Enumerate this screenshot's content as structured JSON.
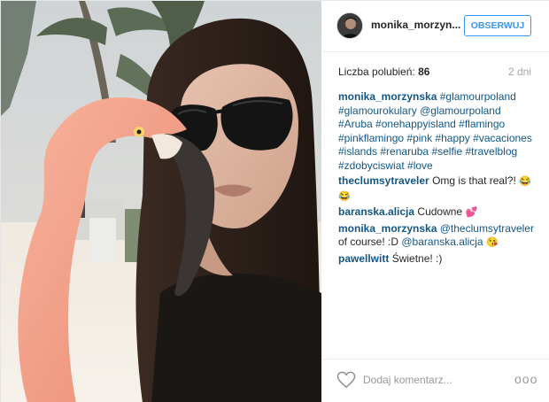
{
  "post": {
    "username": "monika_morzyn...",
    "follow_label": "OBSERWUJ",
    "likes_label": "Liczba polubień:",
    "likes_count": "86",
    "age": "2 dni",
    "comment_placeholder": "Dodaj komentarz...",
    "more_label": "ooo"
  },
  "comments": [
    {
      "user": "monika_morzynska",
      "parts": [
        {
          "type": "tag",
          "text": "#glamourpoland"
        },
        {
          "type": "tag",
          "text": "#glamourokulary"
        },
        {
          "type": "tag",
          "text": "@glamourpoland"
        },
        {
          "type": "tag",
          "text": "#Aruba"
        },
        {
          "type": "tag",
          "text": "#onehappyisland"
        },
        {
          "type": "tag",
          "text": "#flamingo"
        },
        {
          "type": "tag",
          "text": "#pinkflamingo"
        },
        {
          "type": "tag",
          "text": "#pink"
        },
        {
          "type": "tag",
          "text": "#happy"
        },
        {
          "type": "tag",
          "text": "#vacaciones"
        },
        {
          "type": "tag",
          "text": "#islands"
        },
        {
          "type": "tag",
          "text": "#renaruba"
        },
        {
          "type": "tag",
          "text": "#selfie"
        },
        {
          "type": "tag",
          "text": "#travelblog"
        },
        {
          "type": "tag",
          "text": "#zdobyciswiat"
        },
        {
          "type": "tag",
          "text": "#love"
        }
      ]
    },
    {
      "user": "theclumsytraveler",
      "parts": [
        {
          "type": "text",
          "text": "Omg is that real?!"
        },
        {
          "type": "emoji",
          "text": "😂😂"
        }
      ]
    },
    {
      "user": "baranska.alicja",
      "parts": [
        {
          "type": "text",
          "text": "Cudowne"
        },
        {
          "type": "emoji",
          "text": "💕"
        }
      ]
    },
    {
      "user": "monika_morzynska",
      "parts": [
        {
          "type": "tag",
          "text": "@theclumsytraveler"
        },
        {
          "type": "text",
          "text": "of course! :D"
        },
        {
          "type": "tag",
          "text": "@baranska.alicja"
        },
        {
          "type": "emoji",
          "text": "😘"
        }
      ]
    },
    {
      "user": "pawellwitt",
      "parts": [
        {
          "type": "text",
          "text": "Świetne! :)"
        }
      ]
    }
  ],
  "colors": {
    "link": "#125688",
    "follow": "#3897f0",
    "muted": "#a5a7aa"
  },
  "icons": {
    "like": "heart-outline-icon",
    "more": "more-options-icon"
  }
}
